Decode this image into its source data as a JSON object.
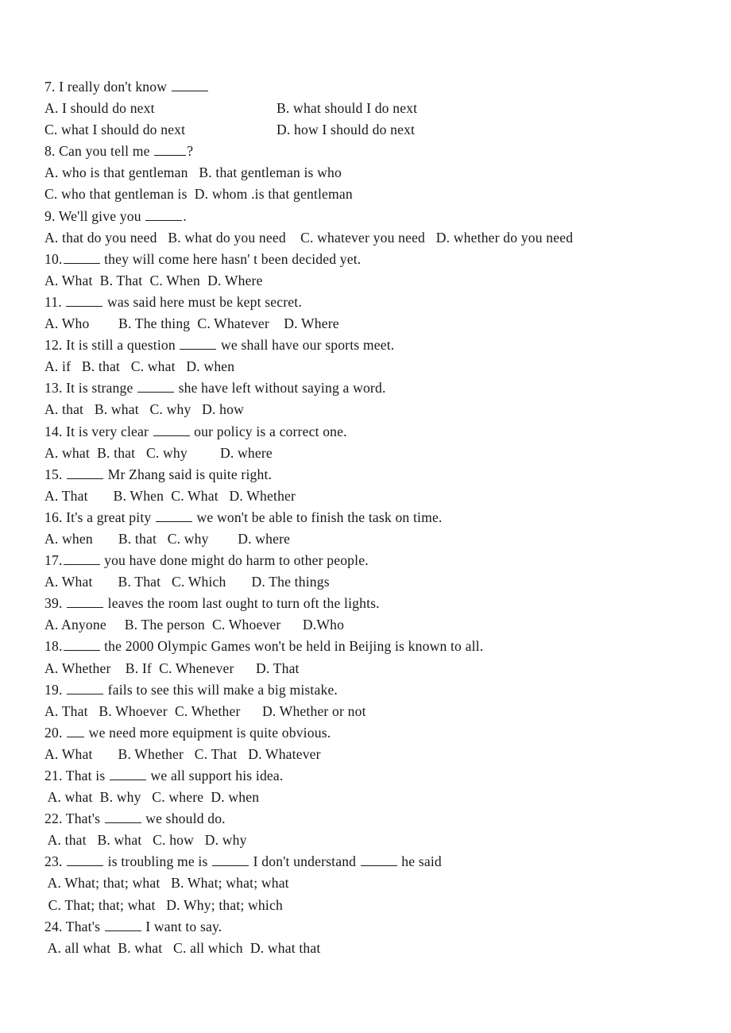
{
  "document": {
    "kind": "grammar-worksheet",
    "background_color": "#ffffff",
    "text_color": "#181818"
  },
  "blank_marker": "_____",
  "questions": [
    {
      "number": "7.",
      "stem_before": "7. I really don't know ",
      "blank": "w5",
      "stem_after": "",
      "stem_text": "7. I really don't know _____",
      "layout": "two-column",
      "rows": [
        {
          "left": "A. I should do next",
          "right": "B. what should I do next"
        },
        {
          "left": "C. what I should do next",
          "right": "D. how I should do next"
        }
      ]
    },
    {
      "number": "8.",
      "stem_before": "8. Can you tell me ",
      "blank": "w4",
      "stem_after": "?",
      "stem_text": "8. Can you tell me _____?",
      "layout": "inline",
      "rows": [
        {
          "text": "A. who is that gentleman   B. that gentleman is who"
        },
        {
          "text": "C. who that gentleman is  D. whom .is that gentleman"
        }
      ]
    },
    {
      "number": "9.",
      "stem_before": "9. We'll give you ",
      "blank": "w5",
      "stem_after": ".",
      "stem_text": "9. We'll give you _____.",
      "layout": "inline",
      "rows": [
        {
          "text": "A. that do you need   B. what do you need    C. whatever you need   D. whether do you need"
        }
      ]
    },
    {
      "number": "10.",
      "stem_before": "10.",
      "blank": "w5",
      "stem_after": " they will come here hasn' t been decided yet.",
      "stem_text": "10._____ they will come here hasn' t been decided yet.",
      "layout": "inline",
      "rows": [
        {
          "text": "A. What  B. That  C. When  D. Where"
        }
      ]
    },
    {
      "number": "11.",
      "stem_before": "11. ",
      "blank": "w5",
      "stem_after": " was said here must be kept secret.",
      "stem_text": "11. _____ was said here must be kept secret.",
      "layout": "inline",
      "rows": [
        {
          "text": "A. Who        B. The thing  C. Whatever    D. Where"
        }
      ]
    },
    {
      "number": "12.",
      "stem_before": "12. It is still a question ",
      "blank": "w5",
      "stem_after": " we shall have our sports meet.",
      "stem_text": "12. It is still a question _____ we shall have our sports meet.",
      "layout": "inline",
      "rows": [
        {
          "text": "A. if   B. that   C. what   D. when"
        }
      ]
    },
    {
      "number": "13.",
      "stem_before": "13. It is strange ",
      "blank": "w5",
      "stem_after": " she have left without saying a word.",
      "stem_text": "13. It is strange _____ she have left without saying a word.",
      "layout": "inline",
      "rows": [
        {
          "text": "A. that   B. what   C. why   D. how"
        }
      ]
    },
    {
      "number": "14.",
      "stem_before": "14. It is very clear ",
      "blank": "w5",
      "stem_after": " our policy is a correct one.",
      "stem_text": "14. It is very clear _____ our policy is a correct one.",
      "layout": "inline",
      "rows": [
        {
          "text": "A. what  B. that   C. why         D. where"
        }
      ]
    },
    {
      "number": "15.",
      "stem_before": "15. ",
      "blank": "w5",
      "stem_after": " Mr Zhang said is quite right.",
      "stem_text": "15. _____ Mr Zhang said is quite right.",
      "layout": "inline",
      "rows": [
        {
          "text": "A. That       B. When  C. What   D. Whether"
        }
      ]
    },
    {
      "number": "16.",
      "stem_before": "16. It's a great pity ",
      "blank": "w5",
      "stem_after": " we won't be able to finish the task on time.",
      "stem_text": "16. It's a great pity _____ we won't be able to finish the task on time.",
      "layout": "inline",
      "rows": [
        {
          "text": "A. when       B. that   C. why        D. where"
        }
      ]
    },
    {
      "number": "17.",
      "stem_before": "17.",
      "blank": "w5",
      "stem_after": " you have done might do harm to other people.",
      "stem_text": "17._____ you have done might do harm to other people.",
      "layout": "inline",
      "rows": [
        {
          "text": "A. What       B. That   C. Which       D. The things"
        }
      ]
    },
    {
      "number": "39.",
      "stem_before": "39. ",
      "blank": "w5",
      "stem_after": " leaves the room last ought to turn oft the lights.",
      "stem_text": "39. _____ leaves the room last ought to turn oft the lights.",
      "layout": "inline",
      "rows": [
        {
          "text": "A. Anyone     B. The person  C. Whoever      D.Who"
        }
      ]
    },
    {
      "number": "18.",
      "stem_before": "18.",
      "blank": "w5",
      "stem_after": " the 2000 Olympic Games won't be held in Beijing is known to all.",
      "stem_text": "18._____ the 2000 Olympic Games won't be held in Beijing is known to all.",
      "layout": "inline",
      "rows": [
        {
          "text": "A. Whether    B. If  C. Whenever      D. That"
        }
      ]
    },
    {
      "number": "19.",
      "stem_before": "19. ",
      "blank": "w5",
      "stem_after": " fails to see this will make a big mistake.",
      "stem_text": "19. _____ fails to see this will make a big mistake.",
      "layout": "inline",
      "rows": [
        {
          "text": "A. That   B. Whoever  C. Whether      D. Whether or not"
        }
      ]
    },
    {
      "number": "20.",
      "stem_before": "20. ",
      "blank": "w2",
      "stem_after": " we need more equipment is quite obvious.",
      "stem_text": "20. __ we need more equipment is quite obvious.",
      "layout": "inline",
      "rows": [
        {
          "text": "A. What       B. Whether   C. That   D. Whatever"
        }
      ]
    },
    {
      "number": "21.",
      "stem_before": "21. That is ",
      "blank": "w5",
      "stem_after": " we all support his idea.",
      "stem_text": "21. That is _____ we all support his idea.",
      "layout": "inline",
      "rows": [
        {
          "text": " A. what  B. why   C. where  D. when"
        }
      ]
    },
    {
      "number": "22.",
      "stem_before": "22. That's ",
      "blank": "w5",
      "stem_after": " we should do.",
      "stem_text": "22. That's _____ we should do.",
      "layout": "inline",
      "rows": [
        {
          "text": " A. that   B. what   C. how   D. why"
        }
      ]
    },
    {
      "number": "23.",
      "stem_before": "23. ",
      "blank": "w5",
      "stem_mid_1": " is troubling me is ",
      "blank_2": "w5",
      "stem_mid_2": " I don't understand ",
      "blank_3": "w5",
      "stem_after": " he said",
      "stem_text": "23. _____ is troubling me is _____ I don't understand _____ he said",
      "layout": "inline",
      "rows": [
        {
          "text": " A. What; that; what   B. What; what; what"
        },
        {
          "text": " C. That; that; what   D. Why; that; which"
        }
      ]
    },
    {
      "number": "24.",
      "stem_before": "24. That's ",
      "blank": "w5",
      "stem_after": " I want to say.",
      "stem_text": "24. That's _____ I want to say.",
      "layout": "inline",
      "rows": [
        {
          "text": " A. all what  B. what   C. all which  D. what that"
        }
      ]
    }
  ]
}
